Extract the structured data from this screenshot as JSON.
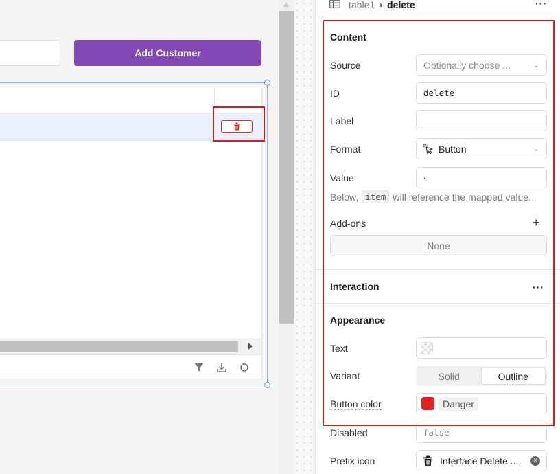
{
  "canvas": {
    "add_customer_label": "Add Customer"
  },
  "inspector": {
    "breadcrumb": {
      "parent": "table1",
      "current": "delete"
    },
    "content": {
      "title": "Content",
      "source_label": "Source",
      "source_placeholder": "Optionally choose ...",
      "id_label": "ID",
      "id_value": "delete",
      "label_label": "Label",
      "label_value": "",
      "format_label": "Format",
      "format_value": "Button",
      "value_label": "Value",
      "value_value": "·",
      "hint_pre": "Below,",
      "hint_code": "item",
      "hint_post": "will reference the mapped value.",
      "addons_label": "Add-ons",
      "addons_none": "None"
    },
    "interaction": {
      "title": "Interaction"
    },
    "appearance": {
      "title": "Appearance",
      "text_label": "Text",
      "variant_label": "Variant",
      "variant_options": [
        "Solid",
        "Outline"
      ],
      "variant_selected": "Outline",
      "button_color_label": "Button color",
      "button_color_value": "Danger",
      "button_color_hex": "#e02424",
      "disabled_label": "Disabled",
      "disabled_value": "false",
      "prefix_icon_label": "Prefix icon",
      "prefix_icon_value": "Interface Delete ..."
    }
  },
  "colors": {
    "accent": "#8549b6",
    "highlight": "#d01c1c",
    "selection": "#8ab4f5"
  }
}
